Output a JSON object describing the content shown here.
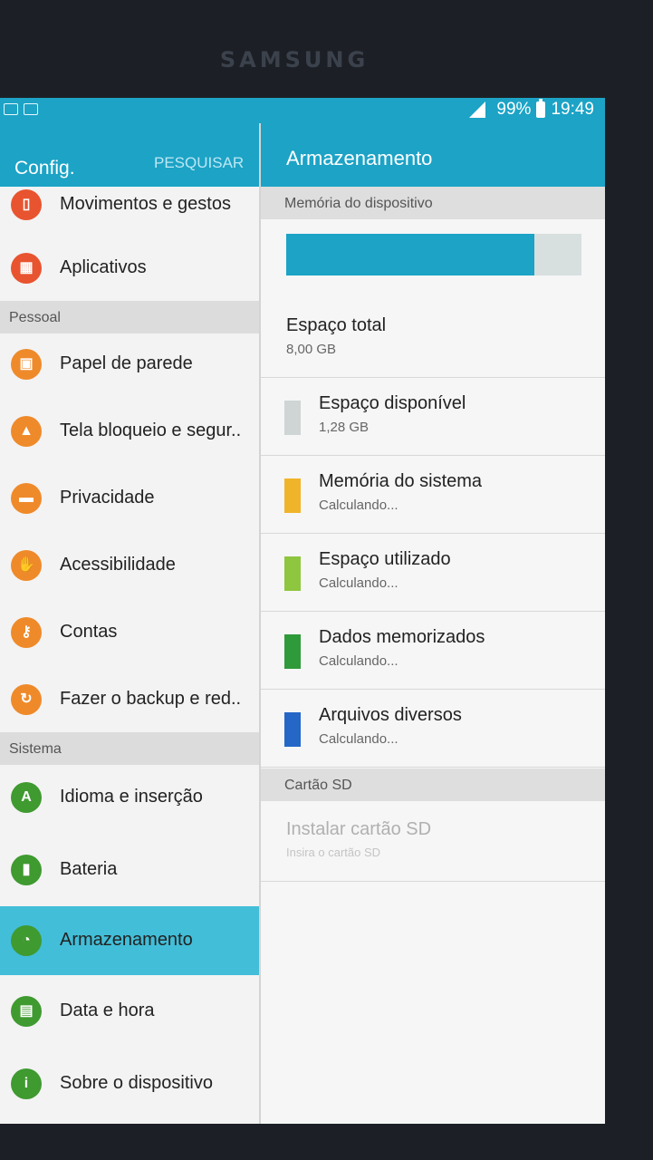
{
  "device": {
    "brand": "SAMSUNG"
  },
  "status_bar": {
    "battery": "99%",
    "time": "19:49"
  },
  "left_header": {
    "title": "Config.",
    "search_label": "PESQUISAR"
  },
  "left_list": {
    "items": [
      {
        "label": "Movimentos e gestos",
        "icon": "gesture-icon",
        "color": "#e8542f"
      },
      {
        "label": "Aplicativos",
        "icon": "apps-grid-icon",
        "color": "#e8542f"
      }
    ],
    "section_personal": "Pessoal",
    "personal": [
      {
        "label": "Papel de parede",
        "icon": "wallpaper-icon",
        "color": "#ef8a2a"
      },
      {
        "label": "Tela bloqueio e segur..",
        "icon": "lock-icon",
        "color": "#ef8a2a"
      },
      {
        "label": "Privacidade",
        "icon": "privacy-icon",
        "color": "#ef8a2a"
      },
      {
        "label": "Acessibilidade",
        "icon": "hand-icon",
        "color": "#ef8a2a"
      },
      {
        "label": "Contas",
        "icon": "key-icon",
        "color": "#ef8a2a"
      },
      {
        "label": "Fazer o backup e red..",
        "icon": "backup-icon",
        "color": "#ef8a2a"
      }
    ],
    "section_system": "Sistema",
    "system": [
      {
        "label": "Idioma e inserção",
        "icon": "language-icon",
        "glyph": "A",
        "color": "#3f9a30"
      },
      {
        "label": "Bateria",
        "icon": "battery-icon",
        "color": "#3f9a30"
      },
      {
        "label": "Armazenamento",
        "icon": "storage-icon",
        "color": "#3f9a30",
        "selected": true
      },
      {
        "label": "Data e hora",
        "icon": "calendar-icon",
        "color": "#3f9a30"
      },
      {
        "label": "Sobre o dispositivo",
        "icon": "info-icon",
        "glyph": "i",
        "color": "#3f9a30"
      }
    ]
  },
  "right_header": {
    "title": "Armazenamento"
  },
  "storage": {
    "section_device": "Memória do dispositivo",
    "used_fraction": 0.84,
    "total": {
      "title": "Espaço total",
      "value": "8,00 GB"
    },
    "rows": [
      {
        "title": "Espaço disponível",
        "value": "1,28 GB",
        "color": "#cfd4d4"
      },
      {
        "title": "Memória do sistema",
        "value": "Calculando...",
        "color": "#f0b42a"
      },
      {
        "title": "Espaço utilizado",
        "value": "Calculando...",
        "color": "#8ec63f"
      },
      {
        "title": "Dados memorizados",
        "value": "Calculando...",
        "color": "#2f9a3a"
      },
      {
        "title": "Arquivos diversos",
        "value": "Calculando...",
        "color": "#2467c7"
      }
    ],
    "section_sd": "Cartão SD",
    "sd": {
      "title": "Instalar cartão SD",
      "subtitle": "Insira o cartão SD"
    }
  }
}
